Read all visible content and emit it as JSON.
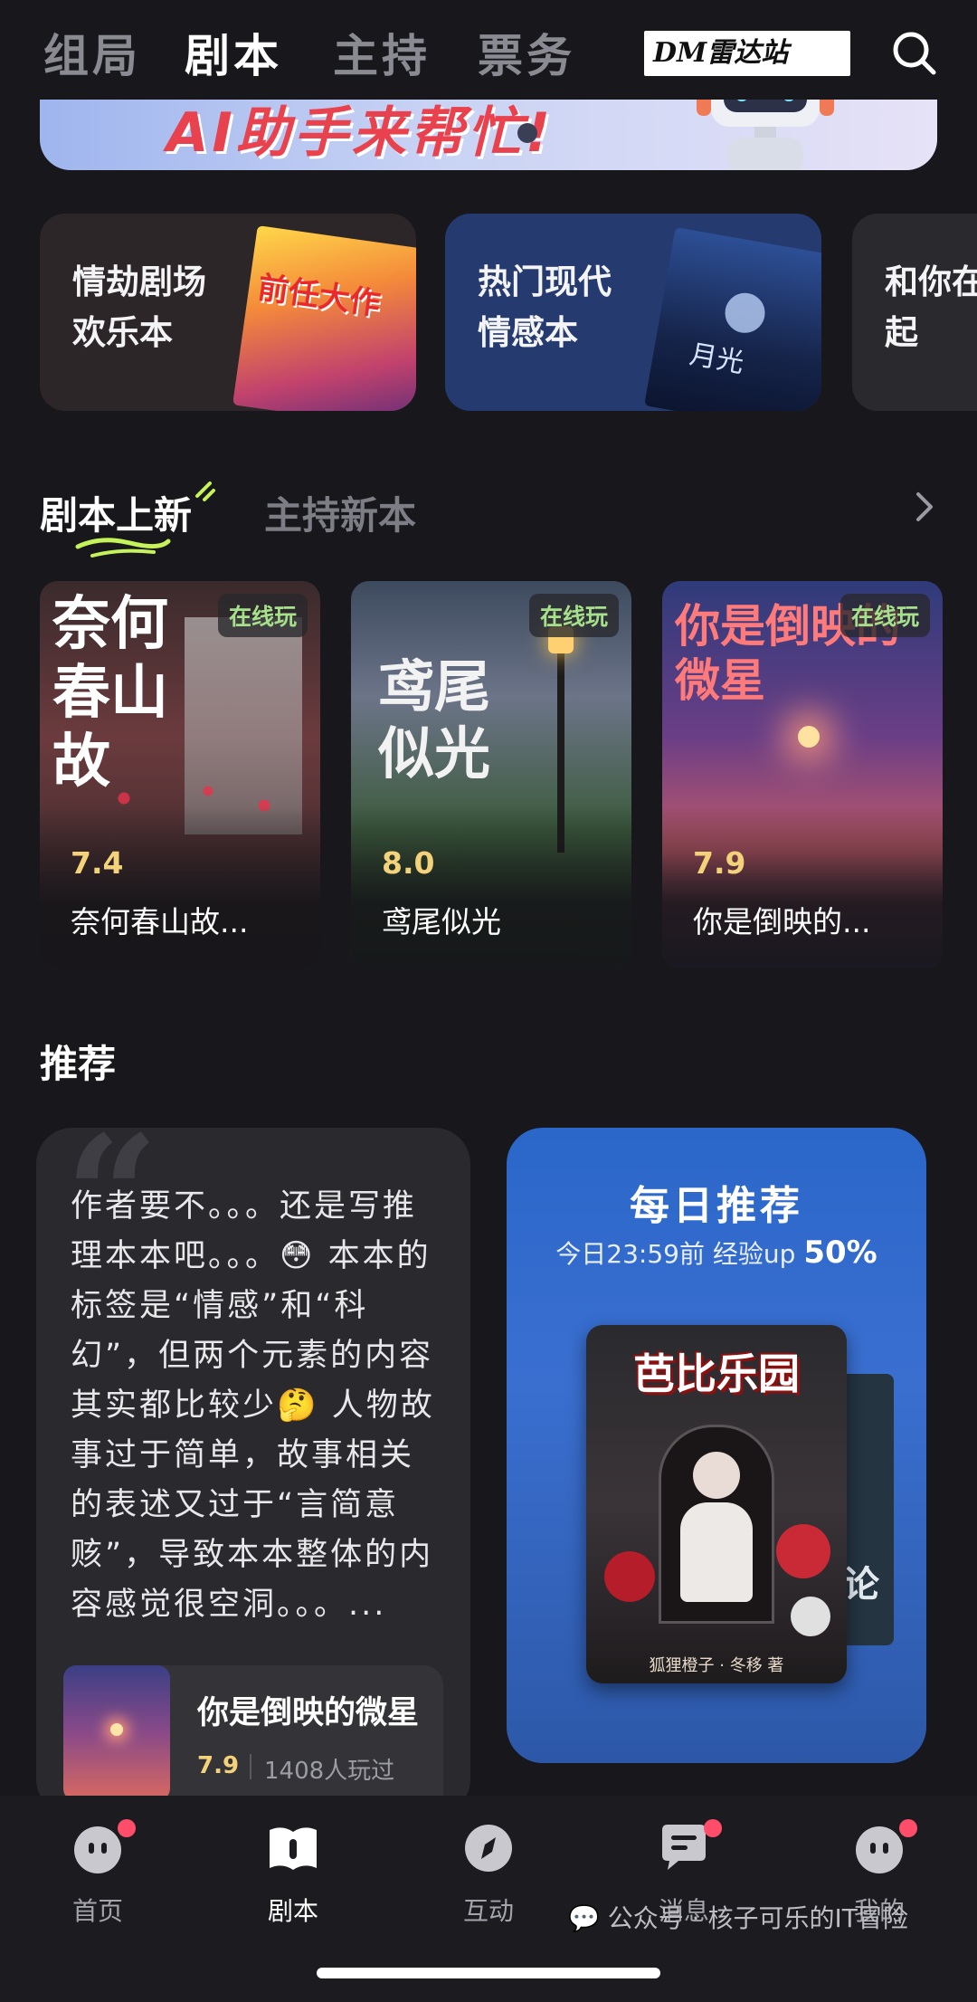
{
  "top_tabs": {
    "items": [
      "组局",
      "剧本",
      "主持",
      "票务"
    ],
    "active": "剧本"
  },
  "watermark_logo": "DM雷达站",
  "ai_banner": {
    "text": "AI助手来帮忙!"
  },
  "categories": [
    {
      "title_line1": "情劫剧场",
      "title_line2": "欢乐本",
      "cover_text": "前任大作"
    },
    {
      "title_line1": "热门现代",
      "title_line2": "情感本",
      "cover_text": "月光"
    },
    {
      "title_line1": "和你在",
      "title_line2": "起"
    }
  ],
  "section_tabs": {
    "active": "剧本上新",
    "inactive": "主持新本"
  },
  "new_scripts": [
    {
      "badge": "在线玩",
      "rating": "7.4",
      "name": "奈何春山故...",
      "cover_text": "奈何春山故"
    },
    {
      "badge": "在线玩",
      "rating": "8.0",
      "name": "鸢尾似光",
      "cover_text": "鸢尾似光"
    },
    {
      "badge": "在线玩",
      "rating": "7.9",
      "name": "你是倒映的...",
      "cover_text": "你是倒映的微星"
    }
  ],
  "recommend": {
    "title": "推荐",
    "review_text": "作者要不。。。还是写推理本本吧。。。😳 本本的标签是“情感”和“科幻”，但两个元素的内容其实都比较少🤔 人物故事过于简单，故事相关的表述又过于“言简意赅”，导致本本整体的内容感觉很空洞。。。...",
    "mini_card": {
      "name": "你是倒映的微星",
      "rating": "7.9",
      "played": "1408人玩过"
    },
    "daily": {
      "title": "每日推荐",
      "sub_prefix": "今日23:59前 经验up",
      "sub_highlight": "50%",
      "book_title": "芭比乐园",
      "book_author": "狐狸橙子 · 冬移 著",
      "side_text": "论"
    }
  },
  "bottom_nav": {
    "items": [
      {
        "label": "首页",
        "icon": "home-face-icon",
        "dot": true
      },
      {
        "label": "剧本",
        "icon": "script-book-icon",
        "dot": false,
        "active": true
      },
      {
        "label": "互动",
        "icon": "compass-icon",
        "dot": false
      },
      {
        "label": "消息",
        "icon": "message-bubble-icon",
        "dot": true
      },
      {
        "label": "我的",
        "icon": "profile-face-icon",
        "dot": true
      }
    ]
  },
  "footer_watermark": "公众号 · 核子可乐的IT冒险",
  "colors": {
    "background": "#18181c",
    "rating": "#f4d27a",
    "badge_text": "#a6e08a",
    "red_dot": "#ff4d6a",
    "daily_blue": "#2a67c9"
  }
}
